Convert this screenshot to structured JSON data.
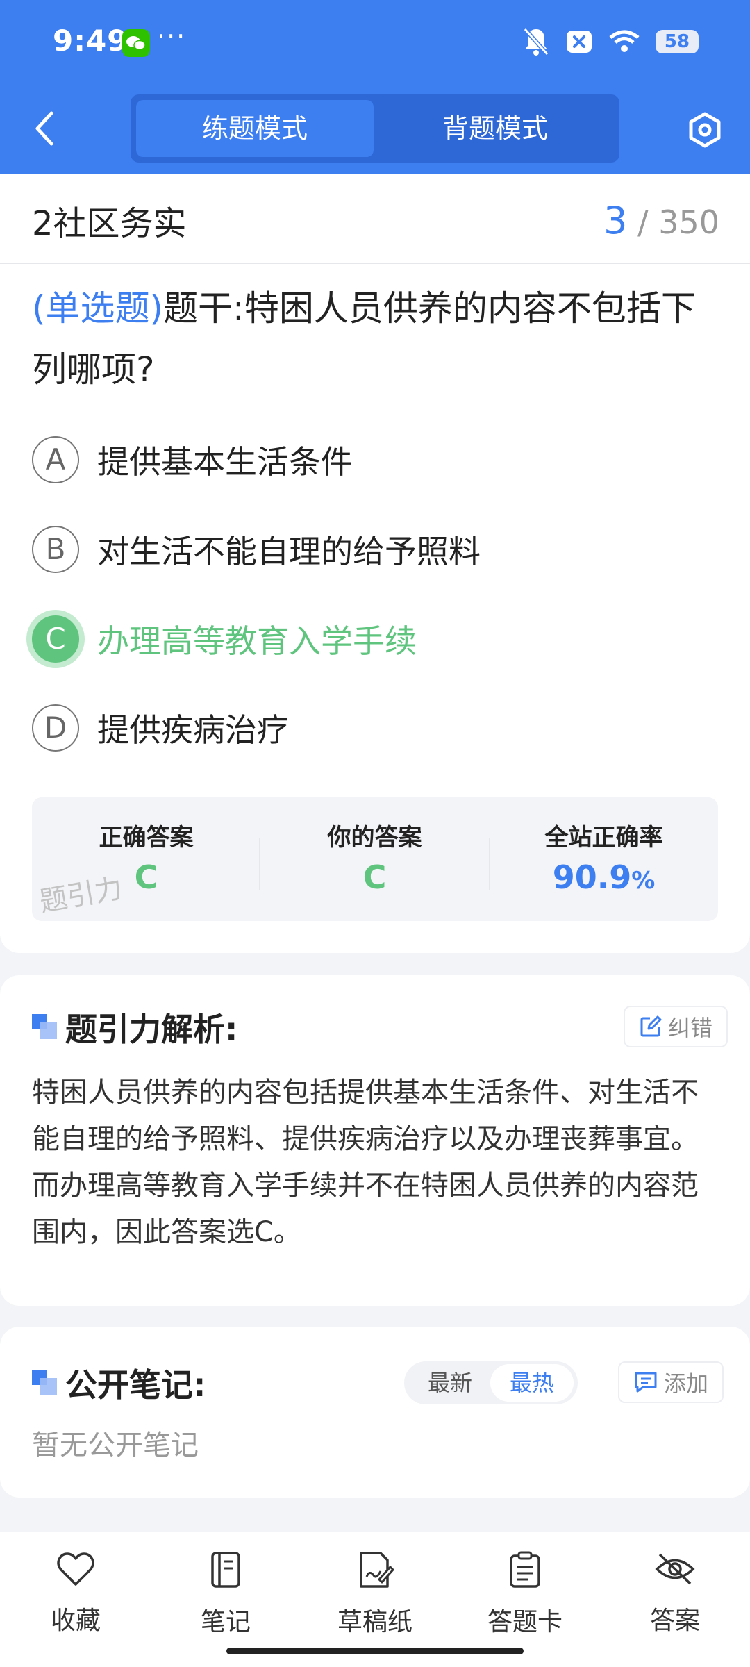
{
  "status_bar": {
    "time": "9:49",
    "dots": "···",
    "battery": "58"
  },
  "header": {
    "tabs": [
      {
        "label": "练题模式",
        "active": true
      },
      {
        "label": "背题模式",
        "active": false
      }
    ],
    "accent": "#3d7ef0"
  },
  "question": {
    "subject": "2社区务实",
    "current": "3",
    "total": "/ 350",
    "type": "(单选题)",
    "stem": "题干:特困人员供养的内容不包括下列哪项?",
    "options": [
      {
        "letter": "A",
        "text": "提供基本生活条件"
      },
      {
        "letter": "B",
        "text": "对生活不能自理的给予照料"
      },
      {
        "letter": "C",
        "text": "办理高等教育入学手续"
      },
      {
        "letter": "D",
        "text": "提供疾病治疗"
      }
    ],
    "correct_color": "#5fc47e"
  },
  "stats": {
    "correct_label": "正确答案",
    "correct_value": "C",
    "yours_label": "你的答案",
    "yours_value": "C",
    "rate_label": "全站正确率",
    "rate_value": "90.9",
    "rate_unit": "%",
    "watermark": "题引力"
  },
  "analysis": {
    "title": "题引力解析:",
    "report_label": "纠错",
    "text": "特困人员供养的内容包括提供基本生活条件、对生活不能自理的给予照料、提供疾病治疗以及办理丧葬事宜。而办理高等教育入学手续并不在特困人员供养的内容范围内，因此答案选C。"
  },
  "notes": {
    "title": "公开笔记:",
    "sort_latest": "最新",
    "sort_hot": "最热",
    "add_label": "添加",
    "empty": "暂无公开笔记"
  },
  "nav": [
    {
      "label": "收藏",
      "icon": "heart-icon"
    },
    {
      "label": "笔记",
      "icon": "notebook-icon"
    },
    {
      "label": "草稿纸",
      "icon": "draft-icon"
    },
    {
      "label": "答题卡",
      "icon": "answer-card-icon"
    },
    {
      "label": "答案",
      "icon": "eye-off-icon"
    }
  ]
}
